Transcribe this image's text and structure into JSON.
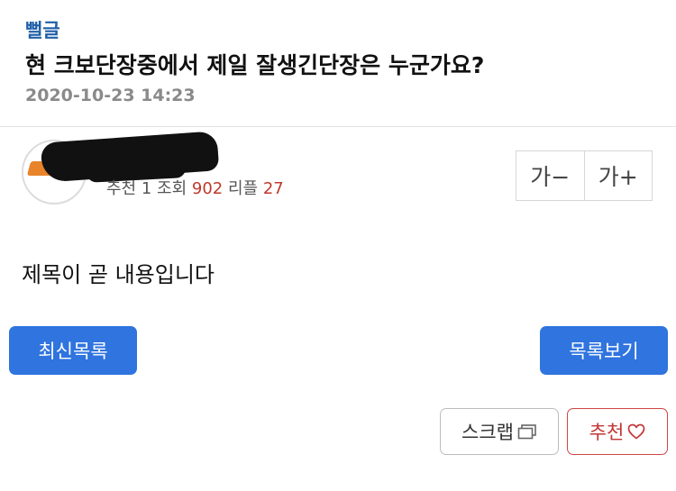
{
  "post": {
    "category": "뻘글",
    "title": "현 크보단장중에서 제일 잘생긴단장은 누군가요?",
    "datetime": "2020-10-23 14:23",
    "body": "제목이 곧 내용입니다"
  },
  "stats": {
    "recommend_label": "추천",
    "recommend_count": "1",
    "views_label": "조회",
    "views_count": "902",
    "replies_label": "리플",
    "replies_count": "27"
  },
  "font_controls": {
    "decrease": "가−",
    "increase": "가+"
  },
  "buttons": {
    "latest_list": "최신목록",
    "view_list": "목록보기",
    "scrap": "스크랩",
    "recommend": "추천"
  },
  "colors": {
    "accent_blue": "#2f74df",
    "category_blue": "#1f5fa8",
    "stat_red": "#c0392b",
    "recommend_red": "#c23636"
  },
  "icons": {
    "scrap": "copy-icon",
    "recommend": "heart-icon"
  }
}
